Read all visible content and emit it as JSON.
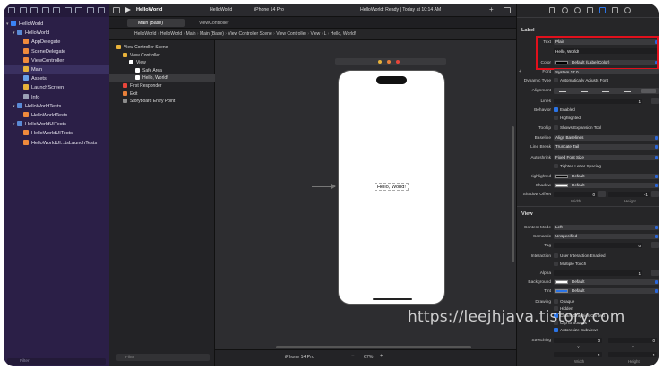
{
  "navigator": {
    "toolbar_icons": [
      "folder-icon",
      "source-control-icon",
      "bookmark-icon",
      "search-icon",
      "warning-icon",
      "test-icon",
      "debug-icon",
      "breakpoint-icon",
      "report-icon"
    ],
    "items": [
      {
        "label": "HelloWorld",
        "depth": 0,
        "icon": "project",
        "expanded": true
      },
      {
        "label": "HelloWorld",
        "depth": 1,
        "icon": "folder",
        "expanded": true
      },
      {
        "label": "AppDelegate",
        "depth": 2,
        "icon": "swift"
      },
      {
        "label": "SceneDelegate",
        "depth": 2,
        "icon": "swift"
      },
      {
        "label": "ViewController",
        "depth": 2,
        "icon": "swift"
      },
      {
        "label": "Main",
        "depth": 2,
        "icon": "storyboard",
        "selected": true
      },
      {
        "label": "Assets",
        "depth": 2,
        "icon": "assets"
      },
      {
        "label": "LaunchScreen",
        "depth": 2,
        "icon": "storyboard"
      },
      {
        "label": "Info",
        "depth": 2,
        "icon": "plist"
      },
      {
        "label": "HelloWorldTests",
        "depth": 1,
        "icon": "folder",
        "expanded": true
      },
      {
        "label": "HelloWorldTests",
        "depth": 2,
        "icon": "swift"
      },
      {
        "label": "HelloWorldUITests",
        "depth": 1,
        "icon": "folder",
        "expanded": true
      },
      {
        "label": "HelloWorldUITests",
        "depth": 2,
        "icon": "swift"
      },
      {
        "label": "HelloWorldUI...tsLaunchTests",
        "depth": 2,
        "icon": "swift"
      }
    ],
    "filter_placeholder": "Filter"
  },
  "toolbar": {
    "project_name": "HelloWorld",
    "scheme": "HelloWorld",
    "device": "iPhone 14 Pro",
    "status": "HelloWorld: Ready | Today at 10:14 AM"
  },
  "tabs": [
    {
      "label": "Main (Base)",
      "active": true
    },
    {
      "label": "ViewController",
      "active": false
    }
  ],
  "breadcrumb": [
    "HelloWorld",
    "HelloWorld",
    "Main",
    "Main (Base)",
    "View Controller Scene",
    "View Controller",
    "View",
    "L",
    "Hello, World!"
  ],
  "outline": {
    "items": [
      {
        "label": "View Controller Scene",
        "depth": 0,
        "color": "#e8b23a"
      },
      {
        "label": "View Controller",
        "depth": 1,
        "color": "#e8b23a"
      },
      {
        "label": "View",
        "depth": 2,
        "color": "#ffffff"
      },
      {
        "label": "Safe Area",
        "depth": 3,
        "color": "#ffffff"
      },
      {
        "label": "Hello, World!",
        "depth": 3,
        "color": "#ffffff",
        "selected": true
      },
      {
        "label": "First Responder",
        "depth": 1,
        "color": "#e8453a"
      },
      {
        "label": "Exit",
        "depth": 1,
        "color": "#e8803a"
      },
      {
        "label": "Storyboard Entry Point",
        "depth": 1,
        "color": "#8c8c8c"
      }
    ],
    "filter_placeholder": "Filter"
  },
  "canvas": {
    "label_text": "Hello, World!",
    "device_label": "iPhone 14 Pro",
    "zoom": "67%"
  },
  "inspector": {
    "label_section": "Label",
    "rows": {
      "text": {
        "label": "Text",
        "value": "Plain"
      },
      "text_value": "Hello, World!",
      "color": {
        "label": "Color",
        "value": "Default (Label Color)"
      },
      "font": {
        "label": "Font",
        "value": "System 17.0"
      },
      "dynamic_type": {
        "label": "Dynamic Type",
        "value": "Automatically Adjusts Font"
      },
      "alignment": {
        "label": "Alignment"
      },
      "lines": {
        "label": "Lines",
        "value": "1"
      },
      "behavior": {
        "label": "Behavior",
        "enabled": "Enabled",
        "highlighted": "Highlighted"
      },
      "tooltip": {
        "label": "Tooltip",
        "value": "Shows Expansion Tool"
      },
      "baseline": {
        "label": "Baseline",
        "value": "Align Baselines"
      },
      "line_break": {
        "label": "Line Break",
        "value": "Truncate Tail"
      },
      "autoshrink": {
        "label": "Autoshrink",
        "value": "Fixed Font Size"
      },
      "tighten": "Tighten Letter Spacing",
      "highlighted": {
        "label": "Highlighted",
        "value": "Default"
      },
      "shadow": {
        "label": "Shadow",
        "value": "Default"
      },
      "shadow_offset": {
        "label": "Shadow Offset",
        "x": "0",
        "y": "-1",
        "width": "Width",
        "height": "Height"
      }
    },
    "view_section": "View",
    "view_rows": {
      "content_mode": {
        "label": "Content Mode",
        "value": "Left"
      },
      "semantic": {
        "label": "Semantic",
        "value": "Unspecified"
      },
      "tag": {
        "label": "Tag",
        "value": "0"
      },
      "interaction": {
        "label": "Interaction",
        "user": "User Interaction Enabled",
        "multiple": "Multiple Touch"
      },
      "alpha": {
        "label": "Alpha",
        "value": "1"
      },
      "background": {
        "label": "Background",
        "value": "Default"
      },
      "tint": {
        "label": "Tint",
        "value": "Default"
      },
      "drawing": {
        "label": "Drawing",
        "opaque": "Opaque",
        "hidden": "Hidden",
        "clears": "Clears Graphics Context",
        "clip": "Clip to Bounds",
        "autoresize": "Autoresize Subviews"
      },
      "stretching": {
        "label": "Stretching",
        "x": "0",
        "y": "0",
        "xl": "X",
        "yl": "Y",
        "w": "1",
        "h": "1",
        "wl": "Width",
        "hl": "Height"
      }
    }
  },
  "watermark": "https://leejhjava.tistory.com",
  "colors": {
    "highlight_box": "#e0101c",
    "sidebar": "#2b1f47",
    "accent": "#2b66d9"
  }
}
